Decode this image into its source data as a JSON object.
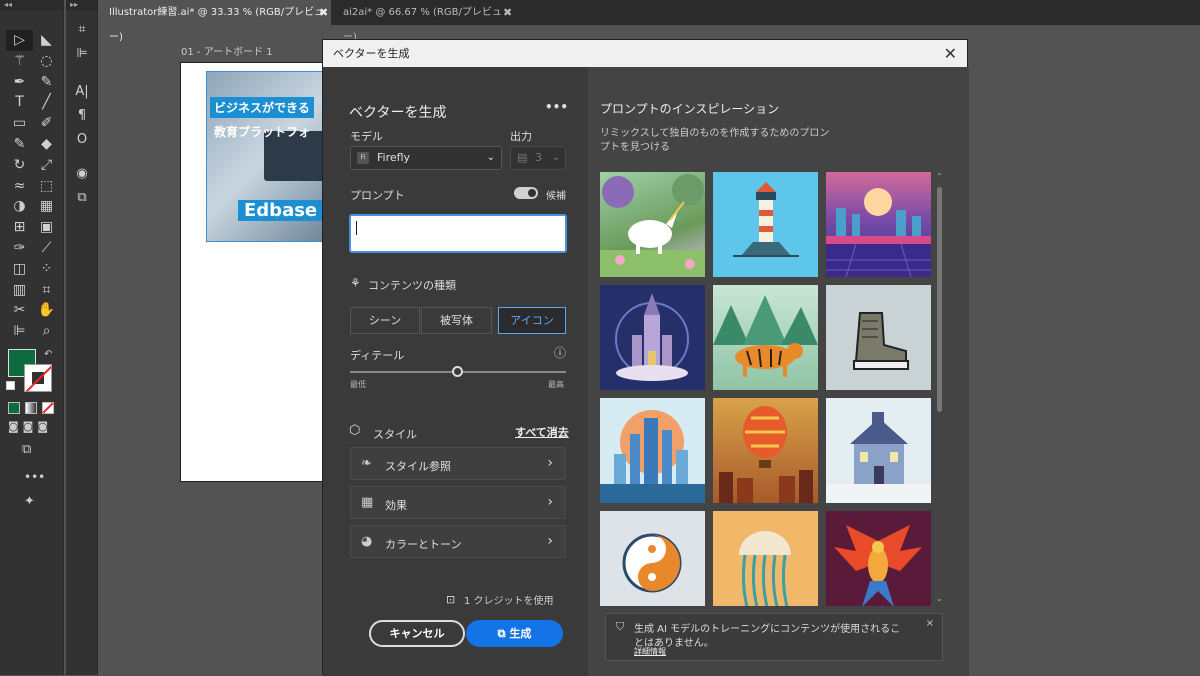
{
  "tabs": [
    {
      "label": "Illustrator練習.ai* @ 33.33 % (RGB/プレビュー)",
      "close": "✖"
    },
    {
      "label": "ai2ai* @ 66.67 % (RGB/プレビュー)",
      "close": "✖"
    }
  ],
  "artboard": {
    "label": "01 - アートボード 1",
    "banner_line1": "ビジネスができる",
    "banner_line2": "教育プラットフォ",
    "banner_line3": "Edbase"
  },
  "colors": {
    "fill": "#0e6b3f",
    "accent": "#1473e6",
    "dialog_bg": "#3a3a3a"
  },
  "dialog": {
    "window_title": "ベクターを生成",
    "close": "✕",
    "panel_title": "ベクターを生成",
    "more": "•••",
    "model_label": "モデル",
    "model_value": "Firefly",
    "model_chip": "Fi",
    "output_label": "出力",
    "output_value": "3",
    "prompt_label": "プロンプト",
    "prompt_value": "",
    "suggest_label": "候補",
    "suggest_on": true,
    "content_type_label": "コンテンツの種類",
    "content_types": [
      "シーン",
      "被写体",
      "アイコン"
    ],
    "content_type_selected": "アイコン",
    "detail_label": "ディテール",
    "detail_min": "最低",
    "detail_max": "最高",
    "detail_value": 0.5,
    "style_label": "スタイル",
    "clear_all": "すべて消去",
    "style_ref": "スタイル参照",
    "effects": "効果",
    "color_tone": "カラーとトーン",
    "credits": "1 クレジットを使用",
    "cancel": "キャンセル",
    "generate": "生成"
  },
  "inspiration": {
    "title": "プロンプトのインスピレーション",
    "subtitle_line1": "リミックスして独自のものを作成するためのプロン",
    "subtitle_line2": "プトを見つける",
    "notice_line1": "生成 AI モデルのトレーニングにコンテンツが使用されるこ",
    "notice_line2": "とはありません。",
    "notice_link": "詳細情報",
    "notice_close": "×"
  }
}
